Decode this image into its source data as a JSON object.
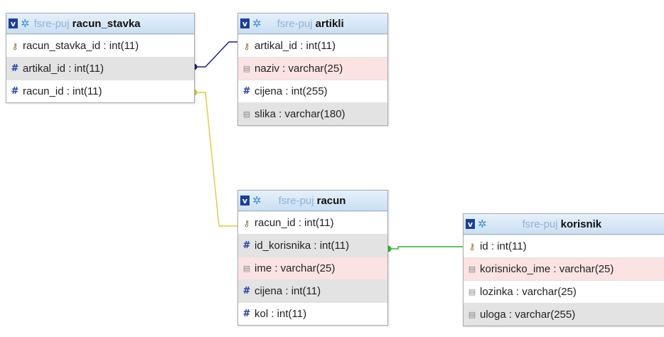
{
  "tables": {
    "racun_stavka": {
      "db": "fsre-puj",
      "name": "racun_stavka",
      "columns": [
        {
          "text": "racun_stavka_id : int(11)",
          "icon": "primary-key-icon"
        },
        {
          "text": "artikal_id : int(11)",
          "icon": "numeric-hash-icon"
        },
        {
          "text": "racun_id : int(11)",
          "icon": "numeric-hash-icon"
        }
      ]
    },
    "artikli": {
      "db": "fsre-puj",
      "name": "artikli",
      "columns": [
        {
          "text": "artikal_id : int(11)",
          "icon": "primary-key-icon"
        },
        {
          "text": "naziv : varchar(25)",
          "icon": "text-field-icon"
        },
        {
          "text": "cijena : int(255)",
          "icon": "numeric-hash-icon"
        },
        {
          "text": "slika : varchar(180)",
          "icon": "text-field-icon"
        }
      ]
    },
    "racun": {
      "db": "fsre-puj",
      "name": "racun",
      "columns": [
        {
          "text": "racun_id : int(11)",
          "icon": "primary-key-icon"
        },
        {
          "text": "id_korisnika : int(11)",
          "icon": "numeric-hash-icon"
        },
        {
          "text": "ime : varchar(25)",
          "icon": "text-field-icon"
        },
        {
          "text": "cijena : int(11)",
          "icon": "numeric-hash-icon"
        },
        {
          "text": "kol : int(11)",
          "icon": "numeric-hash-icon"
        }
      ]
    },
    "korisnik": {
      "db": "fsre-puj",
      "name": "korisnik",
      "columns": [
        {
          "text": "id : int(11)",
          "icon": "primary-key-icon"
        },
        {
          "text": "korisnicko_ime : varchar(25)",
          "icon": "text-field-icon"
        },
        {
          "text": "lozinka : varchar(25)",
          "icon": "text-field-icon"
        },
        {
          "text": "uloga : varchar(255)",
          "icon": "text-field-icon"
        }
      ]
    }
  },
  "header_button": "v",
  "relation_colors": {
    "racun_stavka_artikli": "#1a1a8c",
    "racun_stavka_racun": "#d6cf3a",
    "racun_korisnik": "#2bb52b"
  }
}
